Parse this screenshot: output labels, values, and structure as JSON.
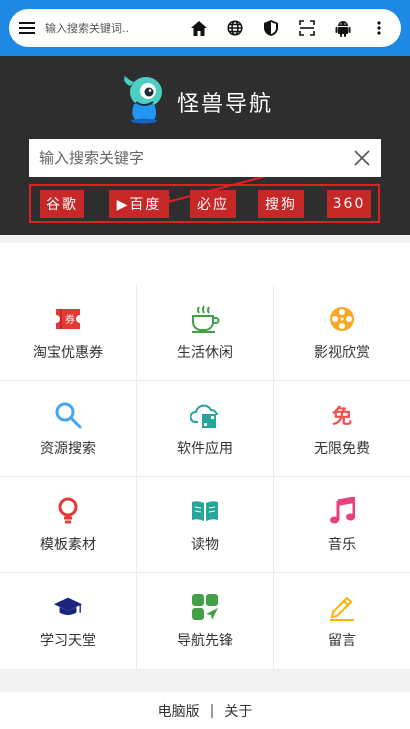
{
  "browser": {
    "address_placeholder": "输入搜索关键词..",
    "tools": [
      "home-icon",
      "globe-icon",
      "shield-icon",
      "scan-icon",
      "android-icon",
      "more-vertical-icon"
    ]
  },
  "header": {
    "brand": "怪兽导航",
    "accent": "#1e88e5",
    "hero_bg": "#2e2e2e"
  },
  "search": {
    "placeholder": "输入搜索关键字",
    "engines": [
      "谷歌",
      "▶百度",
      "必应",
      "搜狗",
      "360"
    ],
    "engine_color": "#c62828"
  },
  "categories": [
    {
      "label": "淘宝优惠券",
      "icon": "coupon-icon",
      "color": "#e53935"
    },
    {
      "label": "生活休闲",
      "icon": "teacup-icon",
      "color": "#43a047"
    },
    {
      "label": "影视欣赏",
      "icon": "film-reel-icon",
      "color": "#f9a825"
    },
    {
      "label": "资源搜索",
      "icon": "search-icon",
      "color": "#42a5f5"
    },
    {
      "label": "软件应用",
      "icon": "cloud-apps-icon",
      "color": "#26a69a"
    },
    {
      "label": "无限免费",
      "icon": "free-icon",
      "color": "#ef5350"
    },
    {
      "label": "模板素材",
      "icon": "bulb-icon",
      "color": "#e53935"
    },
    {
      "label": "读物",
      "icon": "book-icon",
      "color": "#26a69a"
    },
    {
      "label": "音乐",
      "icon": "music-note-icon",
      "color": "#ec407a"
    },
    {
      "label": "学习天堂",
      "icon": "graduation-cap-icon",
      "color": "#1a237e"
    },
    {
      "label": "导航先锋",
      "icon": "navigation-icon",
      "color": "#43a047"
    },
    {
      "label": "留言",
      "icon": "pencil-icon",
      "color": "#ffb300"
    }
  ],
  "footer": {
    "left": "电脑版",
    "separator": "|",
    "right": "关于"
  }
}
